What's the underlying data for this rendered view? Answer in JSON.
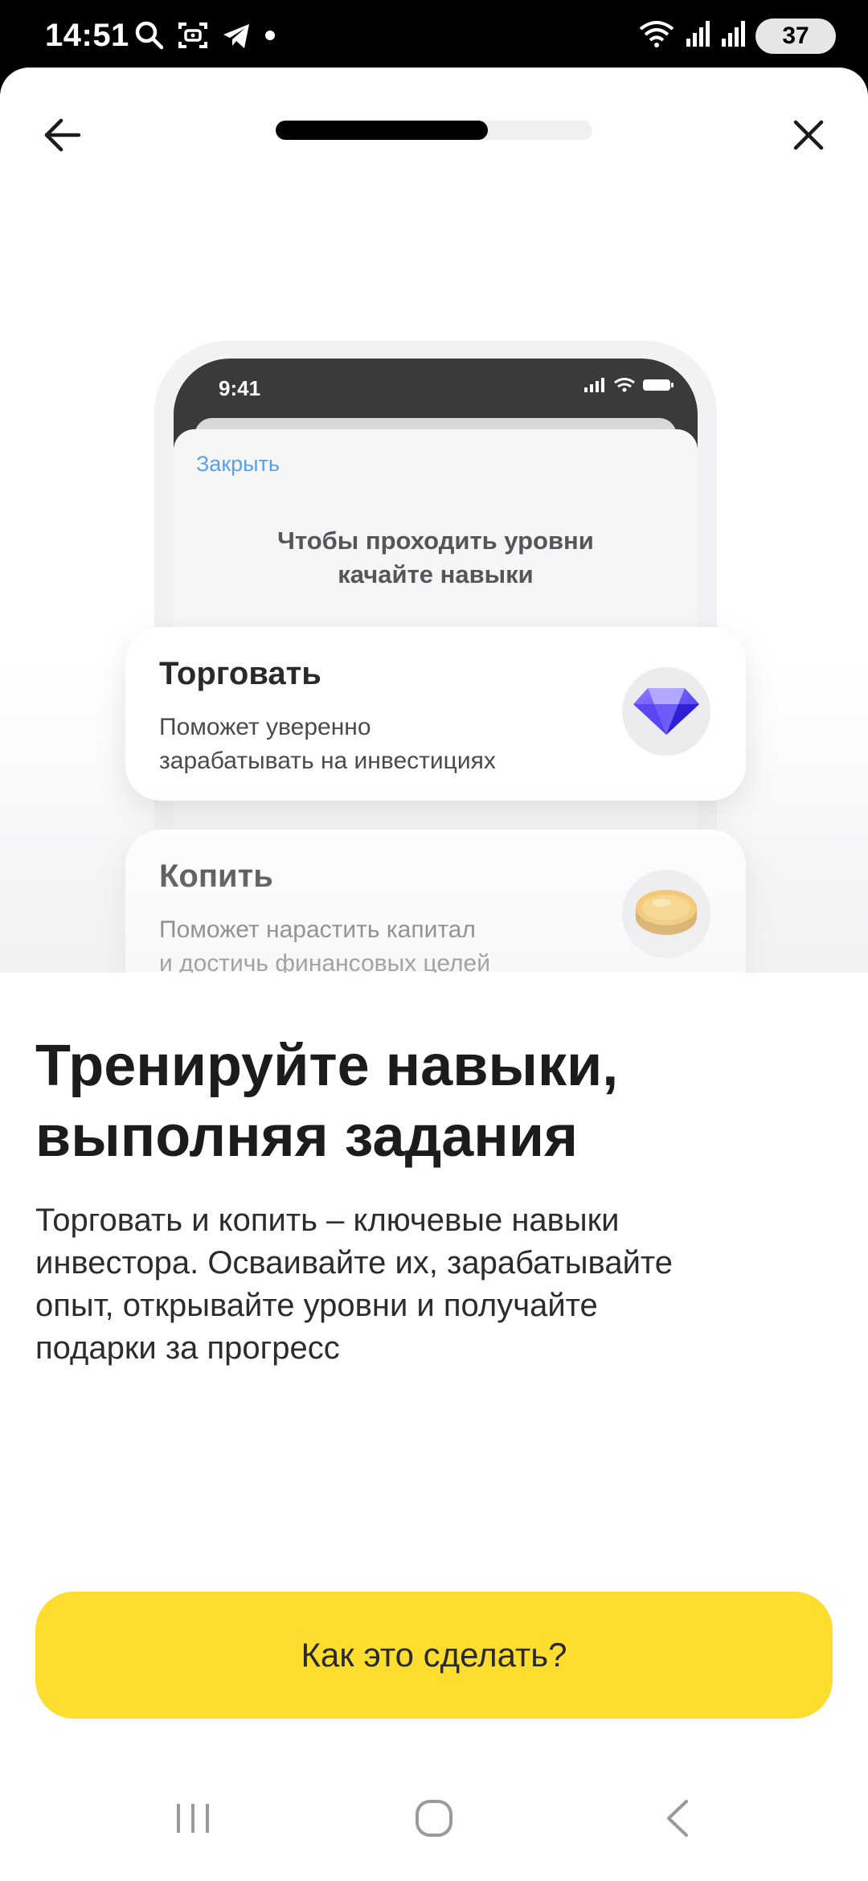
{
  "status_bar": {
    "time": "14:51",
    "battery": "37",
    "icons": [
      "search-icon",
      "screenshot-icon",
      "telegram-icon",
      "notification-dot",
      "wifi-icon",
      "signal-icon",
      "signal-icon"
    ]
  },
  "header": {
    "back_icon": "arrow-left-icon",
    "close_icon": "close-icon",
    "progress_fraction": 0.67
  },
  "illustration": {
    "mock_time": "9:41",
    "mock_close_label": "Закрыть",
    "mock_heading_line1": "Чтобы проходить уровни",
    "mock_heading_line2": "качайте навыки",
    "cards": [
      {
        "title": "Торговать",
        "desc_line1": "Поможет уверенно",
        "desc_line2": "зарабатывать на инвестициях",
        "icon": "diamond-icon"
      },
      {
        "title": "Копить",
        "desc_line1": "Поможет нарастить капитал",
        "desc_line2": "и достичь финансовых целей",
        "icon": "coin-icon"
      }
    ]
  },
  "content": {
    "title_line1": "Тренируйте навыки,",
    "title_line2": "выполняя задания",
    "description_line1": "Торговать и копить – ключевые навыки",
    "description_line2": "инвестора. Осваивайте их, зарабатывайте",
    "description_line3": "опыт, открывайте уровни и получайте",
    "description_line4": "подарки за прогресс"
  },
  "cta": {
    "label": "Как это сделать?",
    "color": "#fddd2d"
  },
  "nav_bar": {
    "icons": [
      "recent-apps-icon",
      "home-icon",
      "back-icon"
    ]
  }
}
